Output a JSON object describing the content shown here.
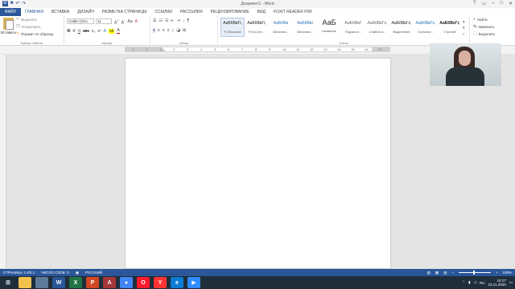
{
  "window": {
    "title": "Документ1 - Word"
  },
  "menu": {
    "tabs": [
      "ФАЙЛ",
      "ГЛАВНАЯ",
      "ВСТАВКА",
      "ДИЗАЙН",
      "РАЗМЕТКА СТРАНИЦЫ",
      "ССЫЛКИ",
      "РАССЫЛКИ",
      "РЕЦЕНЗИРОВАНИЕ",
      "ВИД",
      "FOXIT READER PDF"
    ]
  },
  "clipboard": {
    "paste": "Вставить",
    "cut": "Вырезать",
    "copy": "Копировать",
    "format_painter": "Формат по образцу",
    "label": "Буфер обмена"
  },
  "font": {
    "name": "Calibri (Осн",
    "size": "11",
    "label": "Шрифт"
  },
  "paragraph": {
    "label": "Абзац"
  },
  "styles": {
    "label": "Стили",
    "items": [
      {
        "sample": "АаБбВвГг,",
        "name": "¶ Обычный"
      },
      {
        "sample": "АаБбВвГг,",
        "name": "¶ Без инт..."
      },
      {
        "sample": "АаБбВв",
        "name": "Заголово..."
      },
      {
        "sample": "АаБбВвI",
        "name": "Заголово..."
      },
      {
        "sample": "АаБ",
        "name": "Название"
      },
      {
        "sample": "АаБбВвГ",
        "name": "Подзагол..."
      },
      {
        "sample": "АаБбВвГг,",
        "name": "Слабое в..."
      },
      {
        "sample": "АаБбВвГг,",
        "name": "Выделение"
      },
      {
        "sample": "АаБбВвГг,",
        "name": "Сильное..."
      },
      {
        "sample": "АаБбВеГг,",
        "name": "Строгий"
      }
    ]
  },
  "editing": {
    "find": "Найти",
    "replace": "Заменить",
    "select": "Выделить"
  },
  "ruler": {
    "marks": [
      "1",
      "2",
      "1",
      "2",
      "3",
      "4",
      "5",
      "6",
      "7",
      "8",
      "9",
      "10",
      "11",
      "12",
      "13",
      "14",
      "15",
      "16",
      "17"
    ]
  },
  "status": {
    "page": "СТРАНИЦА 1 ИЗ 1",
    "words": "ЧИСЛО СЛОВ: 0",
    "language": "РУССКИЙ",
    "zoom": "100%"
  },
  "taskbar": {
    "apps": [
      {
        "name": "start",
        "label": "⊞",
        "color": "#1f2e3b"
      },
      {
        "name": "file-explorer",
        "label": "",
        "color": "#f2c14e"
      },
      {
        "name": "explorer-2",
        "label": "",
        "color": "#5d7a9a"
      },
      {
        "name": "word",
        "label": "W",
        "color": "#2b579a"
      },
      {
        "name": "excel",
        "label": "X",
        "color": "#217346"
      },
      {
        "name": "powerpoint",
        "label": "P",
        "color": "#d24726"
      },
      {
        "name": "access",
        "label": "A",
        "color": "#a4373a"
      },
      {
        "name": "chrome",
        "label": "●",
        "color": "#4285f4"
      },
      {
        "name": "opera",
        "label": "O",
        "color": "#ff1b2d"
      },
      {
        "name": "yandex",
        "label": "Y",
        "color": "#f33"
      },
      {
        "name": "edge",
        "label": "e",
        "color": "#0a7cd4"
      },
      {
        "name": "zoom",
        "label": "▶",
        "color": "#2d8cff"
      }
    ],
    "lang": "RU",
    "time": "10:17",
    "date": "23.11.2020"
  }
}
